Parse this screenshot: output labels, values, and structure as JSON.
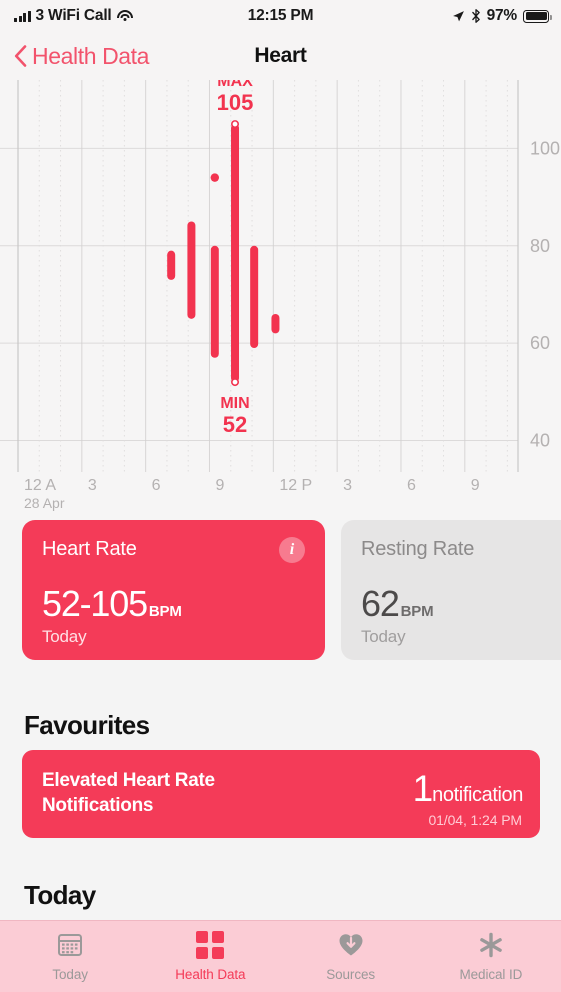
{
  "status_bar": {
    "carrier": "3 WiFi Call",
    "signal_icon": "signal-bars-icon",
    "wifi_icon": "wifi-icon",
    "time": "12:15 PM",
    "location_icon": "location-arrow-icon",
    "bluetooth_icon": "bluetooth-icon",
    "battery_percent": "97%",
    "battery_icon": "battery-full-icon"
  },
  "nav": {
    "back_icon": "chevron-left-icon",
    "back_label": "Health Data",
    "title": "Heart"
  },
  "chart_data": {
    "type": "bar",
    "title": "Heart Rate",
    "xlabel": "",
    "ylabel": "BPM",
    "date_label": "28 Apr",
    "ylim": [
      36,
      112
    ],
    "yticks": [
      40,
      60,
      80,
      100
    ],
    "ytick_labels": [
      "40",
      "60",
      "80",
      "100"
    ],
    "xtick_labels": [
      "12 A",
      "3",
      "6",
      "9",
      "12 P",
      "3",
      "6",
      "9"
    ],
    "xtick_hours": [
      0,
      3,
      6,
      9,
      12,
      15,
      18,
      21
    ],
    "xlim_hours": [
      0,
      23.5
    ],
    "grid": true,
    "series": [
      {
        "name": "Heart Rate range",
        "ranges": [
          {
            "hour": 7.2,
            "low": 73,
            "high": 79
          },
          {
            "hour": 8.15,
            "low": 65,
            "high": 85
          },
          {
            "hour": 9.25,
            "low": 57,
            "high": 80
          },
          {
            "hour": 10.2,
            "low": 52,
            "high": 105
          },
          {
            "hour": 11.1,
            "low": 59,
            "high": 80
          },
          {
            "hour": 12.1,
            "low": 62,
            "high": 66
          }
        ],
        "points": [
          {
            "hour": 9.25,
            "value": 94
          }
        ]
      }
    ],
    "annotations": [
      {
        "label": "MAX",
        "value": 105,
        "hour": 10.2,
        "position": "top"
      },
      {
        "label": "MIN",
        "value": 52,
        "hour": 10.2,
        "position": "bottom"
      }
    ],
    "colors": {
      "bar": "#f2334f",
      "grid": "#dcdada",
      "text": "#b4b1b1"
    }
  },
  "cards": [
    {
      "name": "heart-rate",
      "title": "Heart Rate",
      "value": "52-105",
      "unit": "BPM",
      "subtitle": "Today",
      "info_icon": "info-icon",
      "accent": "#f43b58"
    },
    {
      "name": "resting-rate",
      "title": "Resting Rate",
      "value": "62",
      "unit": "BPM",
      "subtitle": "Today",
      "accent": "#e6e5e5"
    }
  ],
  "favourites": {
    "heading": "Favourites",
    "item": {
      "title": "Elevated Heart Rate Notifications",
      "count": "1",
      "count_label": "notification",
      "timestamp": "01/04, 1:24 PM"
    }
  },
  "today": {
    "heading": "Today"
  },
  "tab_bar": {
    "tabs": [
      {
        "label": "Today",
        "icon": "calendar-icon",
        "active": false
      },
      {
        "label": "Health Data",
        "icon": "grid-squares-icon",
        "active": true
      },
      {
        "label": "Sources",
        "icon": "heart-download-icon",
        "active": false
      },
      {
        "label": "Medical ID",
        "icon": "asterisk-icon",
        "active": false
      }
    ]
  }
}
